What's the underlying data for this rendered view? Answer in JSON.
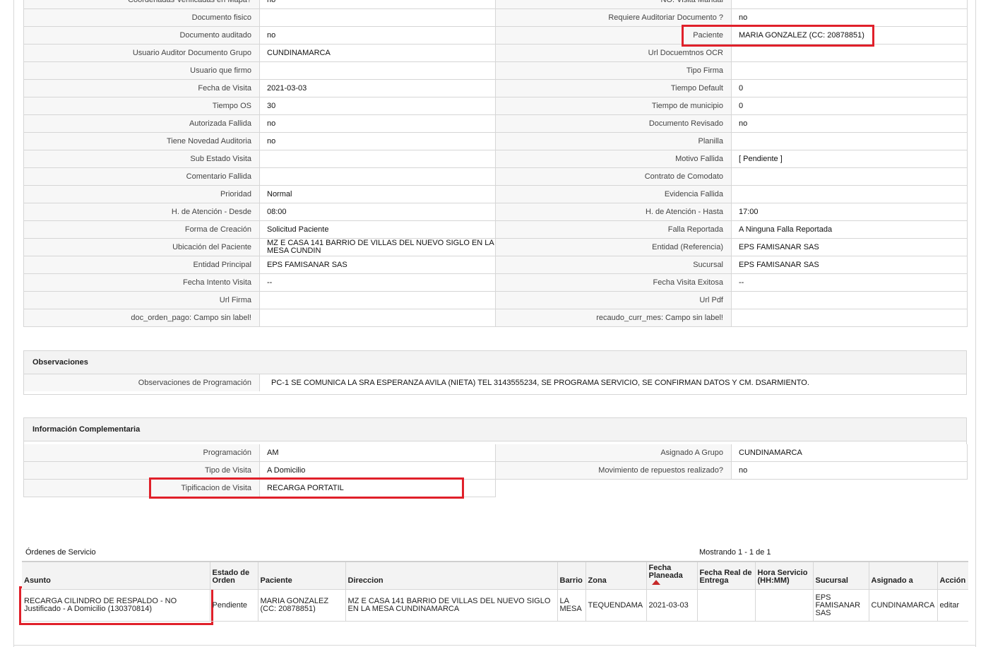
{
  "main_grid": [
    [
      "Coordenadas Verificadas en Mapa?",
      "no",
      "NO. Visita Manual",
      ""
    ],
    [
      "Documento fisico",
      "",
      "Requiere Auditoriar Documento ?",
      "no"
    ],
    [
      "Documento auditado",
      "no",
      "Paciente",
      "MARIA GONZALEZ (CC: 20878851)"
    ],
    [
      "Usuario Auditor Documento Grupo",
      "CUNDINAMARCA",
      "Url Docuemtnos OCR",
      ""
    ],
    [
      "Usuario que firmo",
      "",
      "Tipo Firma",
      ""
    ],
    [
      "Fecha de Visita",
      "2021-03-03",
      "Tiempo Default",
      "0"
    ],
    [
      "Tiempo OS",
      "30",
      "Tiempo de municipio",
      "0"
    ],
    [
      "Autorizada Fallida",
      "no",
      "Documento Revisado",
      "no"
    ],
    [
      "Tiene Novedad Auditoria",
      "no",
      "Planilla",
      ""
    ],
    [
      "Sub Estado Visita",
      "",
      "Motivo Fallida",
      "[ Pendiente ]"
    ],
    [
      "Comentario Fallida",
      "",
      "Contrato de Comodato",
      ""
    ],
    [
      "Prioridad",
      "Normal",
      "Evidencia Fallida",
      ""
    ],
    [
      "H. de Atención - Desde",
      "08:00",
      "H. de Atención - Hasta",
      "17:00"
    ],
    [
      "Forma de Creación",
      "Solicitud Paciente",
      "Falla Reportada",
      "A Ninguna Falla Reportada"
    ],
    [
      "Ubicación del Paciente",
      "MZ E CASA 141 BARRIO DE VILLAS DEL NUEVO SIGLO EN LA MESA CUNDIN",
      "Entidad (Referencia)",
      "EPS FAMISANAR SAS"
    ],
    [
      "Entidad Principal",
      "EPS FAMISANAR SAS",
      "Sucursal",
      "EPS FAMISANAR SAS"
    ],
    [
      "Fecha Intento Visita",
      "--",
      "Fecha Visita Exitosa",
      "--"
    ],
    [
      "Url Firma",
      "",
      "Url Pdf",
      ""
    ],
    [
      "doc_orden_pago: Campo sin label!",
      "",
      "recaudo_curr_mes: Campo sin label!",
      ""
    ]
  ],
  "observaciones": {
    "title": "Observaciones",
    "label": "Observaciones de Programación",
    "value": "PC-1 SE COMUNICA LA SRA ESPERANZA AVILA (NIETA) TEL 3143555234, SE PROGRAMA SERVICIO, SE CONFIRMAN DATOS Y CM. DSARMIENTO."
  },
  "info_complementaria": {
    "title": "Información Complementaria",
    "rows": [
      [
        "Programación",
        "AM",
        "Asignado A Grupo",
        "CUNDINAMARCA"
      ],
      [
        "Tipo de Visita",
        "A Domicilio",
        "Movimiento de repuestos realizado?",
        "no"
      ],
      [
        "Tipificacion de Visita",
        "RECARGA PORTATIL"
      ]
    ]
  },
  "ordenes": {
    "title": "Órdenes de Servicio",
    "count_text": "Mostrando 1 - 1 de 1",
    "headers": [
      "Asunto",
      "Estado de Orden",
      "Paciente",
      "Direccion",
      "Barrio",
      "Zona",
      "Fecha Planeada",
      "Fecha Real de Entrega",
      "Hora Servicio (HH:MM)",
      "Sucursal",
      "Asignado a",
      "Acción"
    ],
    "rows": [
      [
        "RECARGA CILINDRO DE RESPALDO - NO Justificado - A Domicilio (130370814)",
        "Pendiente",
        "MARIA GONZALEZ (CC: 20878851)",
        "MZ E CASA 141 BARRIO DE VILLAS DEL NUEVO SIGLO EN LA MESA CUNDINAMARCA",
        "LA MESA",
        "TEQUENDAMA",
        "2021-03-03",
        "",
        "",
        "EPS FAMISANAR SAS",
        "CUNDINAMARCA",
        "editar"
      ]
    ]
  },
  "colors": {
    "highlight": "#e0202a",
    "label_bg": "#f7f7f7",
    "header_bg": "#f3f3f3",
    "border": "#d6d6d6"
  }
}
